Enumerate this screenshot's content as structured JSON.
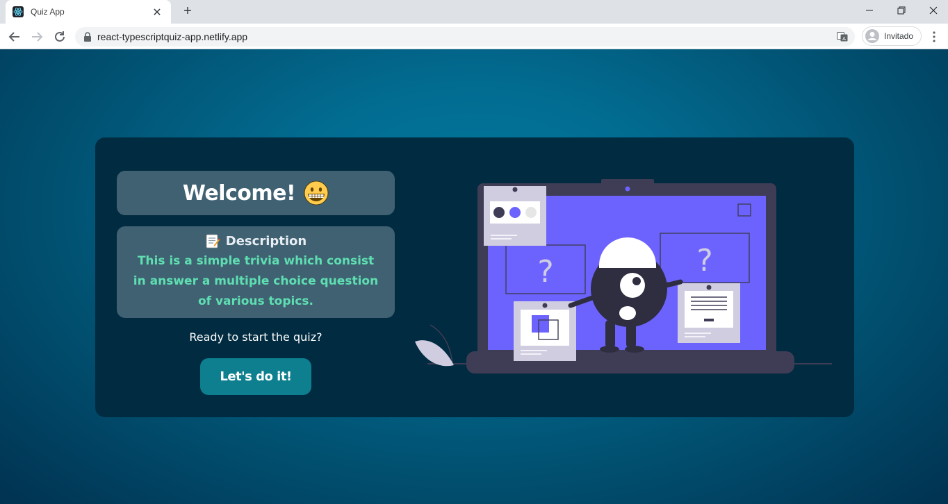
{
  "browser": {
    "tab_title": "Quiz App",
    "url": "react-typescriptquiz-app.netlify.app",
    "profile_label": "Invitado"
  },
  "page": {
    "welcome_title": "Welcome!",
    "description_title": "Description",
    "description_text": "This is a simple trivia which consist in answer a multiple choice question of various topics.",
    "ready_text": "Ready to start the quiz?",
    "start_button": "Let's do it!",
    "illustration_marks": [
      "?",
      "?"
    ]
  },
  "colors": {
    "background": "#026b90",
    "card": "#012b40",
    "box": "#3f6172",
    "description_text": "#5fdfb1",
    "button": "#0d7f8e",
    "screen_accent": "#6c63ff"
  },
  "icons": {
    "welcome_emoji": "grinning-face-icon",
    "description_emoji": "memo-icon"
  }
}
